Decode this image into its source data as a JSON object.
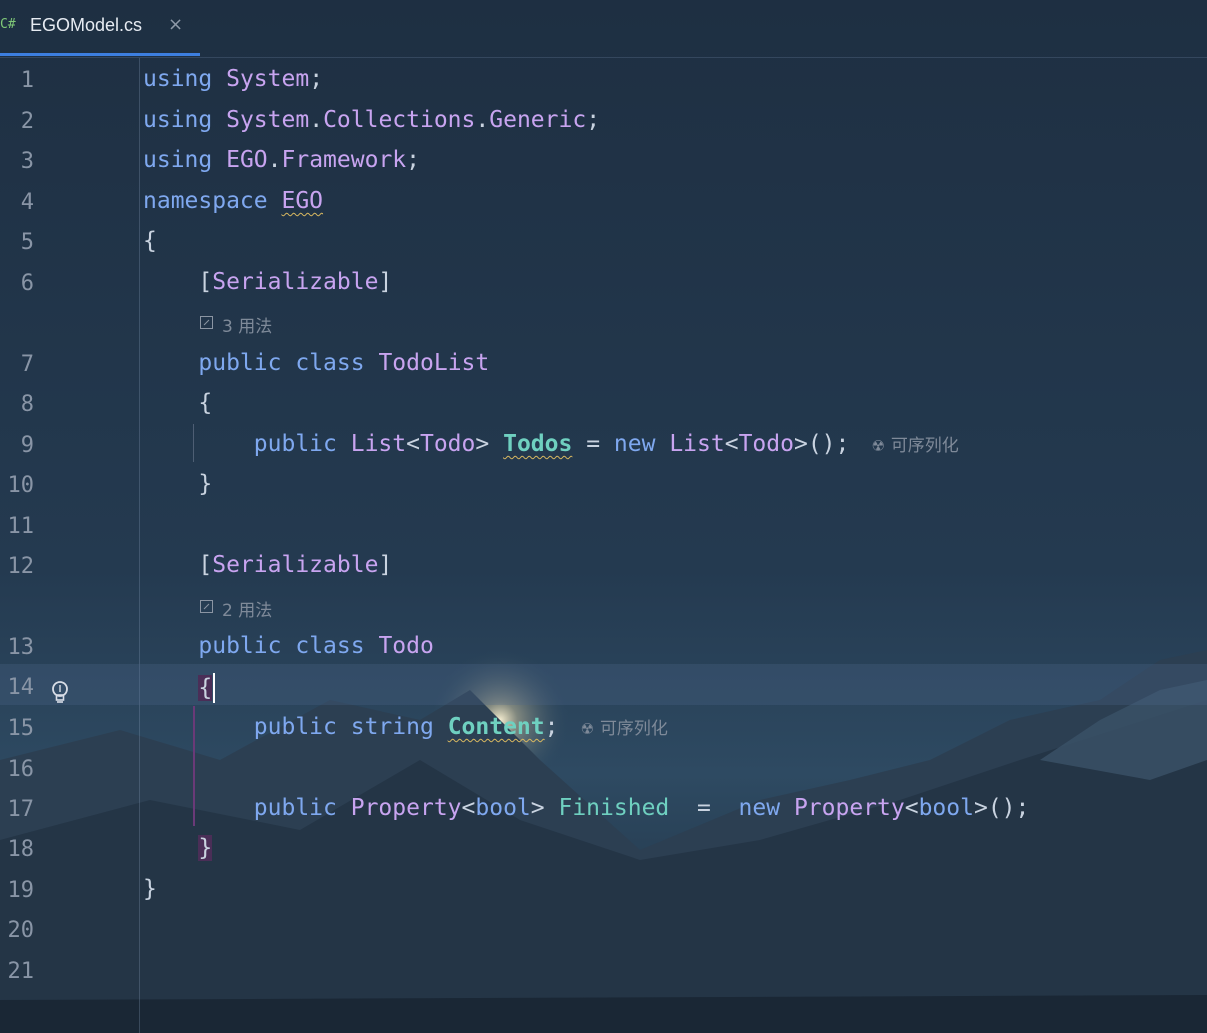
{
  "tab": {
    "lang_badge": "C#",
    "file_name": "EGOModel.cs",
    "close_glyph": "×"
  },
  "editor": {
    "line_numbers": [
      "1",
      "2",
      "3",
      "4",
      "5",
      "6",
      "7",
      "8",
      "9",
      "10",
      "11",
      "12",
      "13",
      "14",
      "15",
      "16",
      "17",
      "18",
      "19",
      "20",
      "21"
    ],
    "lenses": [
      {
        "after_line": 6,
        "text": "3 用法",
        "icon": "goto-usages-icon"
      },
      {
        "after_line": 12,
        "text": "2 用法",
        "icon": "goto-usages-icon"
      }
    ],
    "code": {
      "l1_kw": "using",
      "l1_ns": "System",
      "l1_end": ";",
      "l2_kw": "using",
      "l2_ns1": "System",
      "l2_dot1": ".",
      "l2_ns2": "Collections",
      "l2_dot2": ".",
      "l2_ns3": "Generic",
      "l2_end": ";",
      "l3_kw": "using",
      "l3_ns1": "EGO",
      "l3_dot": ".",
      "l3_ns2": "Framework",
      "l3_end": ";",
      "l4_kw": "namespace",
      "l4_ns": "EGO",
      "l5": "{",
      "l6_open": "[",
      "l6_attr": "Serializable",
      "l6_close": "]",
      "l7_kw1": "public",
      "l7_kw2": "class",
      "l7_name": "TodoList",
      "l8": "{",
      "l9_kw1": "public",
      "l9_t1": "List",
      "l9_lt": "<",
      "l9_t2": "Todo",
      "l9_gt": ">",
      "l9_field": "Todos",
      "l9_eq": "=",
      "l9_new": "new",
      "l9_t3": "List",
      "l9_lt2": "<",
      "l9_t4": "Todo",
      "l9_gt2": ">();",
      "l9_hint": "可序列化",
      "l10": "}",
      "l12_open": "[",
      "l12_attr": "Serializable",
      "l12_close": "]",
      "l13_kw1": "public",
      "l13_kw2": "class",
      "l13_name": "Todo",
      "l14": "{",
      "l15_kw1": "public",
      "l15_kw2": "string",
      "l15_field": "Content",
      "l15_end": ";",
      "l15_hint": "可序列化",
      "l17_kw1": "public",
      "l17_t1": "Property",
      "l17_lt": "<",
      "l17_kw2": "bool",
      "l17_gt": ">",
      "l17_field": "Finished",
      "l17_eq": "=",
      "l17_new": "new",
      "l17_t2": "Property",
      "l17_lt2": "<",
      "l17_kw3": "bool",
      "l17_gt2": ">();",
      "l18": "}",
      "l19": "}"
    }
  },
  "colors": {
    "keyword": "#7fa8ef",
    "type": "#c8a4f0",
    "field": "#6fd0c0",
    "text": "#c9d3e0",
    "tab_accent": "#3d7fe0"
  }
}
